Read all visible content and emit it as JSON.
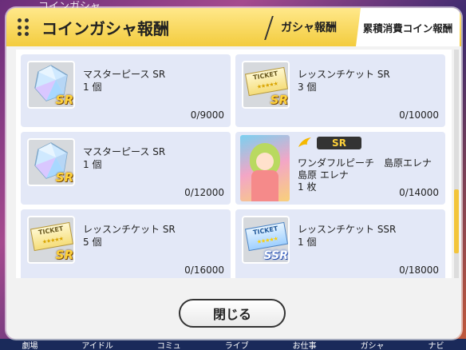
{
  "background": {
    "title": "コインガシャ",
    "nav": [
      "劇場",
      "アイドル",
      "コミュ",
      "ライブ",
      "お仕事",
      "ガシャ",
      "ナビ"
    ]
  },
  "modal": {
    "title": "コインガシャ報酬",
    "tabs": [
      {
        "label": "ガシャ報酬",
        "active": false
      },
      {
        "label": "累積消費コイン報酬",
        "active": true
      }
    ],
    "rewards": [
      {
        "name": "マスターピース SR",
        "qty": "1 個",
        "progress": "0/9000",
        "icon": "crystal-sr-icon",
        "badge": "SR"
      },
      {
        "name": "レッスンチケット SR",
        "qty": "3 個",
        "progress": "0/10000",
        "icon": "ticket-sr-icon",
        "badge": "SR",
        "ticket": "TICKET",
        "stars": "★★★★★"
      },
      {
        "name": "マスターピース SR",
        "qty": "1 個",
        "progress": "0/12000",
        "icon": "crystal-sr-icon",
        "badge": "SR"
      },
      {
        "name": "ワンダフルピーチ　島原エレナ",
        "name2": "島原 エレナ",
        "qty": "1 枚",
        "progress": "0/14000",
        "icon": "idol-card-icon",
        "rarity": "SR"
      },
      {
        "name": "レッスンチケット SR",
        "qty": "5 個",
        "progress": "0/16000",
        "icon": "ticket-sr-icon",
        "badge": "SR",
        "ticket": "TICKET",
        "stars": "★★★★★"
      },
      {
        "name": "レッスンチケット SSR",
        "qty": "1 個",
        "progress": "0/18000",
        "icon": "ticket-ssr-icon",
        "badge": "SSR",
        "ticket": "TICKET",
        "stars": "★★★★★"
      }
    ],
    "close_label": "閉じる"
  },
  "colors": {
    "header": "#f3cc3e",
    "card": "#e3e8f7",
    "scrollbar_thumb": "#f3c53a"
  }
}
